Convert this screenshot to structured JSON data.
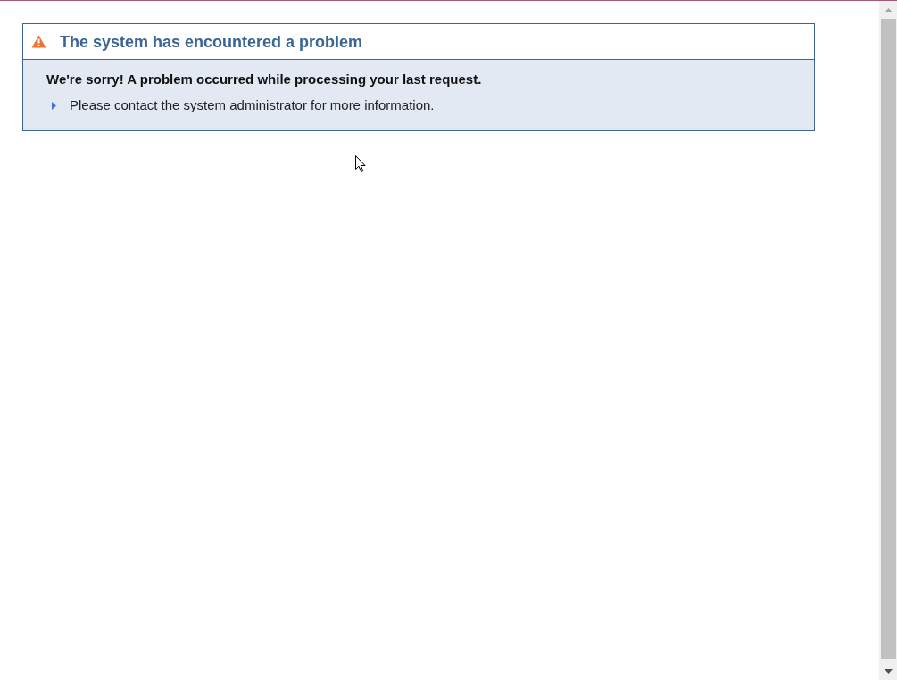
{
  "alert": {
    "title": "The system has encountered a problem",
    "message": "We're sorry! A problem occurred while processing your last request.",
    "details": [
      "Please contact the system administrator for more information."
    ]
  }
}
